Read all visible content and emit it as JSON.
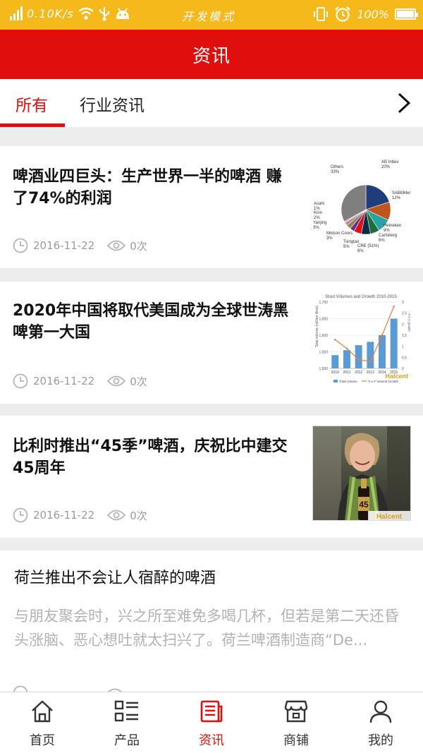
{
  "status_bar": {
    "network_speed": "0.10K/s",
    "mode": "开发模式",
    "battery": "100%",
    "battery_level": 1.0
  },
  "header": {
    "title": "资讯"
  },
  "tabs": [
    {
      "label": "所有",
      "active": true
    },
    {
      "label": "行业资讯",
      "active": false
    }
  ],
  "articles": [
    {
      "title": "啤酒业四巨头：生产世界一半的啤酒 赚了74%的利润",
      "date": "2016-11-22",
      "views": "0次",
      "thumb": {
        "type": "pie",
        "slices": [
          {
            "label": "AB Inbev",
            "pct_label": "20%",
            "value": 20,
            "color": "#1f3d7a"
          },
          {
            "label": "SABMiller",
            "pct_label": "12%",
            "value": 12,
            "color": "#c0541d"
          },
          {
            "label": "Heineken",
            "pct_label": "9%",
            "value": 9,
            "color": "#2aa3a3"
          },
          {
            "label": "Carlsberg",
            "pct_label": "6%",
            "value": 6,
            "color": "#1b6e3a"
          },
          {
            "label": "CRE (51%)",
            "pct_label": "6%",
            "value": 6,
            "color": "#0e2a44"
          },
          {
            "label": "Tsingtao",
            "pct_label": "5%",
            "value": 5,
            "color": "#d8121b"
          },
          {
            "label": "Molson Coors",
            "pct_label": "3%",
            "value": 3,
            "color": "#6b2e8a"
          },
          {
            "label": "Yanjing",
            "pct_label": "3%",
            "value": 3,
            "color": "#8a8a4a"
          },
          {
            "label": "Kirin",
            "pct_label": "2%",
            "value": 2,
            "color": "#b57ab5"
          },
          {
            "label": "Asahi",
            "pct_label": "1%",
            "value": 1,
            "color": "#d2b48c"
          },
          {
            "label": "Others",
            "pct_label": "33%",
            "value": 33,
            "color": "#7f7f7f"
          }
        ]
      }
    },
    {
      "title": "2020年中国将取代美国成为全球世涛黑啤第一大国",
      "date": "2016-11-22",
      "views": "0次",
      "thumb": {
        "type": "bar-line",
        "title": "Stout Volumes and Growth 2010-2015",
        "ylabel": "Total volume (million litres)",
        "y2label": "Y-o-Y growth",
        "yticks": [
          "1,700",
          "1,650",
          "1,600",
          "1,550",
          "1,500"
        ],
        "y2ticks": [
          "3",
          "2.5",
          "2",
          "1.5",
          "1",
          "0.5",
          "0"
        ],
        "categories": [
          "2010",
          "2011",
          "2012",
          "2013",
          "2014",
          "2015"
        ],
        "bar_values": [
          1540,
          1555,
          1570,
          1580,
          1600,
          1650
        ],
        "line_values": [
          1.3,
          0.9,
          0.4,
          0.3,
          1.5,
          2.8
        ],
        "legend": [
          "Total Volume",
          "Y-o-Y Volume Growth"
        ],
        "watermark": "Halcent"
      }
    },
    {
      "title": "比利时推出“45季”啤酒，庆祝比中建交45周年",
      "date": "2016-11-22",
      "views": "0次",
      "thumb": {
        "type": "photo",
        "bottle_label": "45",
        "watermark": "Halcent"
      }
    },
    {
      "title": "荷兰推出不会让人宿醉的啤酒",
      "excerpt": "与朋友聚会时，兴之所至难免多喝几杯，但若是第二天还昏头涨脑、恶心想吐就太扫兴了。荷兰啤酒制造商“De..."
    }
  ],
  "bottom_nav": [
    {
      "label": "首页",
      "icon": "home-icon",
      "active": false
    },
    {
      "label": "产品",
      "icon": "list-icon",
      "active": false
    },
    {
      "label": "资讯",
      "icon": "news-icon",
      "active": true
    },
    {
      "label": "商铺",
      "icon": "store-icon",
      "active": false
    },
    {
      "label": "我的",
      "icon": "user-icon",
      "active": false
    }
  ],
  "colors": {
    "primary": "#e10e0e",
    "status_bar": "#f5b91c",
    "meta": "#9a9a9a"
  }
}
